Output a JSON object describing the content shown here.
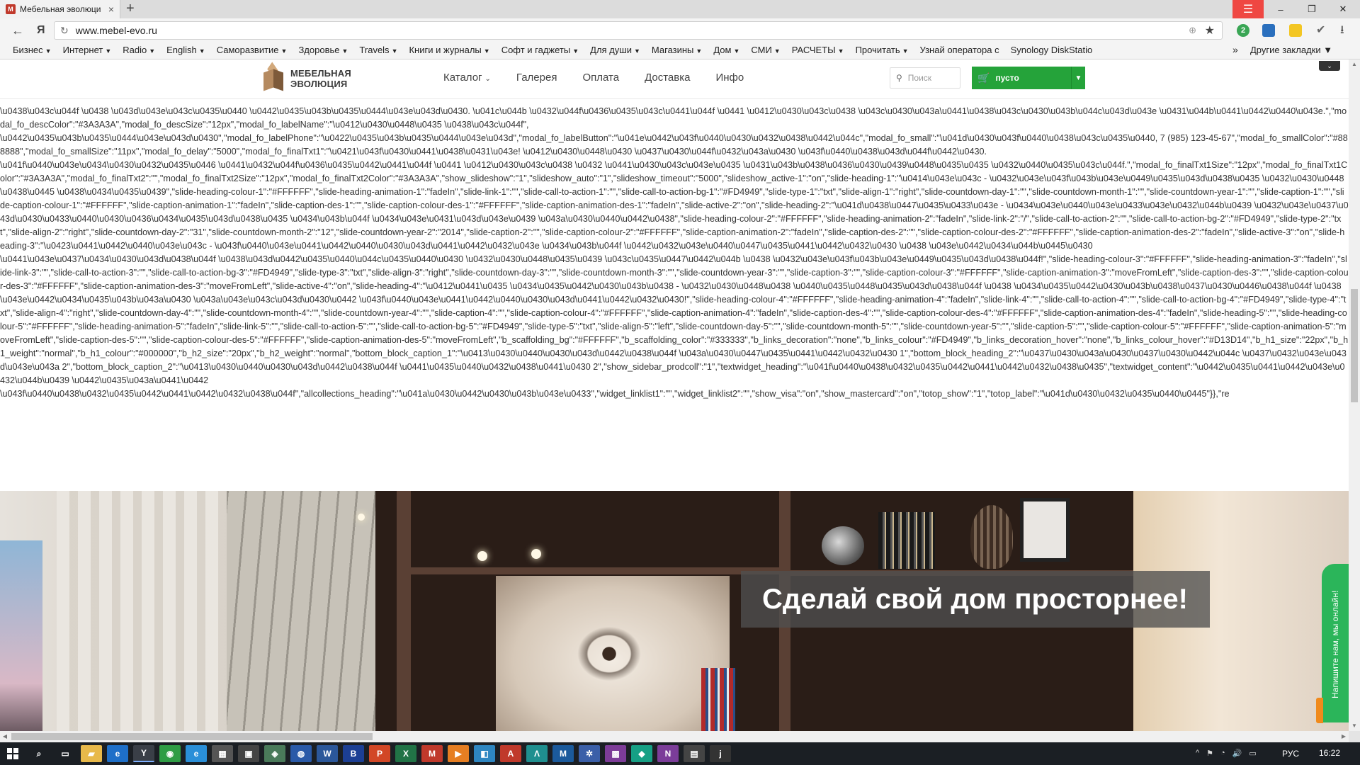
{
  "browser": {
    "tab_title": "Мебельная эволюци",
    "tab_close": "×",
    "new_tab": "+",
    "url": "www.mebel-evo.ru",
    "window_controls": {
      "menu": "☰",
      "minimize": "–",
      "maximize": "❐",
      "close": "✕"
    },
    "nav": {
      "back": "←",
      "yandex": "Я",
      "reload": "↻",
      "star": "★",
      "protect": "⊕",
      "download": "⭳"
    },
    "badge_count": "2",
    "extensions": [
      {
        "name": "green-badge-icon",
        "color": "#3aa655"
      },
      {
        "name": "bookmark-ext-icon",
        "color": "#2a6fbd"
      },
      {
        "name": "note-ext-icon",
        "color": "#f3c623"
      },
      {
        "name": "check-ext-icon",
        "color": "#666666"
      }
    ]
  },
  "bookmarks": {
    "items": [
      {
        "label": "Бизнес",
        "caret": "▼"
      },
      {
        "label": "Интернет",
        "caret": "▼"
      },
      {
        "label": "Radio",
        "caret": "▼"
      },
      {
        "label": "English",
        "caret": "▼"
      },
      {
        "label": "Саморазвитие",
        "caret": "▼"
      },
      {
        "label": "Здоровье",
        "caret": "▼"
      },
      {
        "label": "Travels",
        "caret": "▼"
      },
      {
        "label": "Книги и журналы",
        "caret": "▼"
      },
      {
        "label": "Софт и гаджеты",
        "caret": "▼"
      },
      {
        "label": "Для души",
        "caret": "▼"
      },
      {
        "label": "Магазины",
        "caret": "▼"
      },
      {
        "label": "Дом",
        "caret": "▼"
      },
      {
        "label": "СМИ",
        "caret": "▼"
      },
      {
        "label": "РАСЧЕТЫ",
        "caret": "▼"
      },
      {
        "label": "Прочитать",
        "caret": "▼"
      },
      {
        "label": "Узнай оператора с",
        "caret": ""
      },
      {
        "label": "Synology DiskStatio",
        "caret": ""
      }
    ],
    "more": "»",
    "other": "Другие закладки ▼"
  },
  "site": {
    "logo_line1": "МЕБЕЛЬНАЯ",
    "logo_line2": "ЭВОЛЮЦИЯ",
    "nav": [
      {
        "label": "Каталог",
        "caret": "⌄"
      },
      {
        "label": "Галерея",
        "caret": ""
      },
      {
        "label": "Оплата",
        "caret": ""
      },
      {
        "label": "Доставка",
        "caret": ""
      },
      {
        "label": "Инфо",
        "caret": ""
      }
    ],
    "search_placeholder": "Поиск",
    "cart_label": "пусто",
    "cart_dropdown": "▼",
    "collapse": "⌄"
  },
  "leaked_text": [
    "\\u0438\\u043c\\u044f \\u0438 \\u043d\\u043e\\u043c\\u0435\\u0440 \\u0442\\u0435\\u043b\\u0435\\u0444\\u043e\\u043d\\u0430. \\u041c\\u044b \\u0432\\u044f\\u0436\\u0435\\u043c\\u0441\\u044f \\u0441 \\u0412\\u0430\\u043c\\u0438 \\u043c\\u0430\\u043a\\u0441\\u0438\\u043c\\u0430\\u043b\\u044c\\u043d\\u043e \\u0431\\u044b\\u0441\\u0442\\u0440\\u043e.\",\"modal_fo_descColor\":\"#3A3A3A\",\"modal_fo_descSize\":\"12px\",\"modal_fo_labelName\":\"\\u0412\\u0430\\u0448\\u0435 \\u0438\\u043c\\u044f\",",
    "\\u0442\\u0435\\u043b\\u0435\\u0444\\u043e\\u043d\\u0430\",\"modal_fo_labelPhone\":\"\\u0422\\u0435\\u043b\\u0435\\u0444\\u043e\\u043d\",\"modal_fo_labelButton\":\"\\u041e\\u0442\\u043f\\u0440\\u0430\\u0432\\u0438\\u0442\\u044c\",\"modal_fo_small\":\"\\u041d\\u0430\\u043f\\u0440\\u0438\\u043c\\u0435\\u0440, 7 (985) 123-45-67\",\"modal_fo_smallColor\":\"#888888\",\"modal_fo_smallSize\":\"11px\",\"modal_fo_delay\":\"5000\",\"modal_fo_finalTxt1\":\"\\u0421\\u043f\\u0430\\u0441\\u0438\\u0431\\u043e! \\u0412\\u0430\\u0448\\u0430 \\u0437\\u0430\\u044f\\u0432\\u043a\\u0430 \\u043f\\u0440\\u0438\\u043d\\u044f\\u0442\\u0430.",
    "\\u041f\\u0440\\u043e\\u0434\\u0430\\u0432\\u0435\\u0446 \\u0441\\u0432\\u044f\\u0436\\u0435\\u0442\\u0441\\u044f \\u0441 \\u0412\\u0430\\u043c\\u0438 \\u0432 \\u0441\\u0430\\u043c\\u043e\\u0435 \\u0431\\u043b\\u0438\\u0436\\u0430\\u0439\\u0448\\u0435\\u0435 \\u0432\\u0440\\u0435\\u043c\\u044f.\",\"modal_fo_finalTxt1Size\":\"12px\",\"modal_fo_finalTxt1Color\":\"#3A3A3A\",\"modal_fo_finalTxt2\":\"\",\"modal_fo_finalTxt2Size\":\"12px\",\"modal_fo_finalTxt2Color\":\"#3A3A3A\",\"show_slideshow\":\"1\",\"slideshow_auto\":\"1\",\"slideshow_timeout\":\"5000\",\"slideshow_active-1\":\"on\",\"slide-heading-1\":\"\\u0414\\u043e\\u043c - \\u0432\\u043e\\u043f\\u043b\\u043e\\u0449\\u0435\\u043d\\u0438\\u0435 \\u0432\\u0430\\u0448\\u0438\\u0445 \\u0438\\u0434\\u0435\\u0439\",\"slide-heading-colour-1\":\"#FFFFFF\",\"slide-heading-animation-1\":\"fadeIn\",\"slide-link-1\":\"\",\"slide-call-to-action-1\":\"\",\"slide-call-to-action-bg-1\":\"#FD4949\",\"slide-type-1\":\"txt\",\"slide-align-1\":\"right\",\"slide-countdown-day-1\":\"\",\"slide-countdown-month-1\":\"\",\"slide-countdown-year-1\":\"\",\"slide-caption-1\":\"\",\"slide-caption-colour-1\":\"#FFFFFF\",\"slide-caption-animation-1\":\"fadeIn\",\"slide-caption-des-1\":\"\",\"slide-caption-colour-des-1\":\"#FFFFFF\",\"slide-caption-animation-des-1\":\"fadeIn\",\"slide-active-2\":\"on\",\"slide-heading-2\":\"\\u041d\\u0438\\u0447\\u0435\\u0433\\u043e - \\u0434\\u043e\\u0440\\u043e\\u0433\\u043e\\u0432\\u044b\\u0439 \\u0432\\u043e\\u0437\\u043d\\u0430\\u0433\\u0440\\u0430\\u0436\\u0434\\u0435\\u043d\\u0438\\u0435 \\u0434\\u043b\\u044f \\u0434\\u043e\\u0431\\u043d\\u043e\\u0439 \\u043a\\u0430\\u0440\\u0442\\u0438\",\"slide-heading-colour-2\":\"#FFFFFF\",\"slide-heading-animation-2\":\"fadeIn\",\"slide-link-2\":\"/\",\"slide-call-to-action-2\":\"\",\"slide-call-to-action-bg-2\":\"#FD4949\",\"slide-type-2\":\"txt\",\"slide-align-2\":\"right\",\"slide-countdown-day-2\":\"31\",\"slide-countdown-month-2\":\"12\",\"slide-countdown-year-2\":\"2014\",\"slide-caption-2\":\"\",\"slide-caption-colour-2\":\"#FFFFFF\",\"slide-caption-animation-2\":\"fadeIn\",\"slide-caption-des-2\":\"\",\"slide-caption-colour-des-2\":\"#FFFFFF\",\"slide-caption-animation-des-2\":\"fadeIn\",\"slide-active-3\":\"on\",\"slide-heading-3\":\"\\u0423\\u0441\\u0442\\u0440\\u043e\\u043c - \\u043f\\u0440\\u043e\\u0441\\u0442\\u0440\\u0430\\u043d\\u0441\\u0442\\u0432\\u043e \\u0434\\u043b\\u044f \\u0442\\u0432\\u043e\\u0440\\u0447\\u0435\\u0441\\u0442\\u0432\\u0430 \\u0438 \\u043e\\u0442\\u0434\\u044b\\u0445\\u0430",
    "\\u0441\\u043e\\u0437\\u0434\\u0430\\u043d\\u0438\\u044f \\u0438\\u043d\\u0442\\u0435\\u0440\\u044c\\u0435\\u0440\\u0430 \\u0432\\u0430\\u0448\\u0435\\u0439 \\u043c\\u0435\\u0447\\u0442\\u044b \\u0438 \\u0432\\u043e\\u043f\\u043b\\u043e\\u0449\\u0435\\u043d\\u0438\\u044f!\",\"slide-heading-colour-3\":\"#FFFFFF\",\"slide-heading-animation-3\":\"fadeIn\",\"slide-link-3\":\"\",\"slide-call-to-action-3\":\"\",\"slide-call-to-action-bg-3\":\"#FD4949\",\"slide-type-3\":\"txt\",\"slide-align-3\":\"right\",\"slide-countdown-day-3\":\"\",\"slide-countdown-month-3\":\"\",\"slide-countdown-year-3\":\"\",\"slide-caption-3\":\"\",\"slide-caption-colour-3\":\"#FFFFFF\",\"slide-caption-animation-3\":\"moveFromLeft\",\"slide-caption-des-3\":\"\",\"slide-caption-colour-des-3\":\"#FFFFFF\",\"slide-caption-animation-des-3\":\"moveFromLeft\",\"slide-active-4\":\"on\",\"slide-heading-4\":\"\\u0412\\u0441\\u0435 \\u0434\\u0435\\u0442\\u0430\\u043b\\u0438 - \\u0432\\u0430\\u0448\\u0438 \\u0440\\u0435\\u0448\\u0435\\u043d\\u0438\\u044f \\u0438 \\u0434\\u0435\\u0442\\u0430\\u043b\\u0438\\u0437\\u0430\\u0446\\u0438\\u044f \\u0438 \\u043e\\u0442\\u0434\\u0435\\u043b\\u043a\\u0430 \\u043a\\u043e\\u043c\\u043d\\u0430\\u0442 \\u043f\\u0440\\u043e\\u0441\\u0442\\u0440\\u0430\\u043d\\u0441\\u0442\\u0432\\u0430!\",\"slide-heading-colour-4\":\"#FFFFFF\",\"slide-heading-animation-4\":\"fadeIn\",\"slide-link-4\":\"\",\"slide-call-to-action-4\":\"\",\"slide-call-to-action-bg-4\":\"#FD4949\",\"slide-type-4\":\"txt\",\"slide-align-4\":\"right\",\"slide-countdown-day-4\":\"\",\"slide-countdown-month-4\":\"\",\"slide-countdown-year-4\":\"\",\"slide-caption-4\":\"\",\"slide-caption-colour-4\":\"#FFFFFF\",\"slide-caption-animation-4\":\"fadeIn\",\"slide-caption-des-4\":\"\",\"slide-caption-colour-des-4\":\"#FFFFFF\",\"slide-caption-animation-des-4\":\"fadeIn\",\"slide-heading-5\":\"\",\"slide-heading-colour-5\":\"#FFFFFF\",\"slide-heading-animation-5\":\"fadeIn\",\"slide-link-5\":\"\",\"slide-call-to-action-5\":\"\",\"slide-call-to-action-bg-5\":\"#FD4949\",\"slide-type-5\":\"txt\",\"slide-align-5\":\"left\",\"slide-countdown-day-5\":\"\",\"slide-countdown-month-5\":\"\",\"slide-countdown-year-5\":\"\",\"slide-caption-5\":\"\",\"slide-caption-colour-5\":\"#FFFFFF\",\"slide-caption-animation-5\":\"moveFromLeft\",\"slide-caption-des-5\":\"\",\"slide-caption-colour-des-5\":\"#FFFFFF\",\"slide-caption-animation-des-5\":\"moveFromLeft\",\"b_scaffolding_bg\":\"#FFFFFF\",\"b_scaffolding_color\":\"#333333\",\"b_links_decoration\":\"none\",\"b_links_colour\":\"#FD4949\",\"b_links_decoration_hover\":\"none\",\"b_links_colour_hover\":\"#D13D14\",\"b_h1_size\":\"22px\",\"b_h1_weight\":\"normal\",\"b_h1_colour\":\"#000000\",\"b_h2_size\":\"20px\",\"b_h2_weight\":\"normal\",\"bottom_block_caption_1\":\"\\u0413\\u0430\\u0440\\u0430\\u043d\\u0442\\u0438\\u044f \\u043a\\u0430\\u0447\\u0435\\u0441\\u0442\\u0432\\u0430 1\",\"bottom_block_heading_2\":\"\\u0437\\u0430\\u043a\\u0430\\u0437\\u0430\\u0442\\u044c \\u0437\\u0432\\u043e\\u043d\\u043e\\u043a 2\",\"bottom_block_caption_2\":\"\\u0413\\u0430\\u0440\\u0430\\u043d\\u0442\\u0438\\u044f \\u0441\\u0435\\u0440\\u0432\\u0438\\u0441\\u0430 2\",\"show_sidebar_prodcoll\":\"1\",\"textwidget_heading\":\"\\u041f\\u0440\\u0438\\u0432\\u0435\\u0442\\u0441\\u0442\\u0432\\u0438\\u0435\",\"textwidget_content\":\"\\u0442\\u0435\\u0441\\u0442\\u043e\\u0432\\u044b\\u0439 \\u0442\\u0435\\u043a\\u0441\\u0442",
    "\\u043f\\u0440\\u0438\\u0432\\u0435\\u0442\\u0441\\u0442\\u0432\\u0438\\u044f\",\"allcollections_heading\":\"\\u041a\\u0430\\u0442\\u0430\\u043b\\u043e\\u0433\",\"widget_linklist1\":\"\",\"widget_linklist2\":\"\",\"show_visa\":\"on\",\"show_mastercard\":\"on\",\"totop_show\":\"1\",\"totop_label\":\"\\u041d\\u0430\\u0432\\u0435\\u0440\\u0445\"}},\"re"
  ],
  "hero": {
    "caption": "Сделай свой дом просторнее!"
  },
  "chat": {
    "label": "Напишите нам, мы онлайн!"
  },
  "scroll": {
    "up": "▲",
    "down": "▼",
    "left": "◀",
    "right": "▶"
  },
  "taskbar": {
    "icons": [
      {
        "name": "search-icon",
        "glyph": "⌕",
        "bg": "transparent"
      },
      {
        "name": "task-view-icon",
        "glyph": "▭",
        "bg": "transparent"
      },
      {
        "name": "explorer-icon",
        "glyph": "▰",
        "bg": "#e8b94a"
      },
      {
        "name": "edge-icon",
        "glyph": "e",
        "bg": "#1e6fc8"
      },
      {
        "name": "yandex-browser-icon",
        "glyph": "Y",
        "bg": "#3a3f47"
      },
      {
        "name": "chrome-icon",
        "glyph": "◉",
        "bg": "#2f9d45"
      },
      {
        "name": "ie-icon",
        "glyph": "e",
        "bg": "#2a8fd8"
      },
      {
        "name": "store-icon",
        "glyph": "▦",
        "bg": "#555555"
      },
      {
        "name": "app-icon",
        "glyph": "▣",
        "bg": "#444444"
      },
      {
        "name": "app2-icon",
        "glyph": "◈",
        "bg": "#4a7a5a"
      },
      {
        "name": "app3-icon",
        "glyph": "◍",
        "bg": "#2a5aa8"
      },
      {
        "name": "word-icon",
        "glyph": "W",
        "bg": "#2b579a"
      },
      {
        "name": "app4-icon",
        "glyph": "B",
        "bg": "#1c3f94"
      },
      {
        "name": "powerpoint-icon",
        "glyph": "P",
        "bg": "#d24726"
      },
      {
        "name": "excel-icon",
        "glyph": "X",
        "bg": "#217346"
      },
      {
        "name": "mail-icon",
        "glyph": "M",
        "bg": "#c0392b"
      },
      {
        "name": "app5-icon",
        "glyph": "▶",
        "bg": "#e67e22"
      },
      {
        "name": "app6-icon",
        "glyph": "◧",
        "bg": "#2e86c1"
      },
      {
        "name": "acrobat-icon",
        "glyph": "A",
        "bg": "#c0392b"
      },
      {
        "name": "app7-icon",
        "glyph": "Λ",
        "bg": "#1f8f8f"
      },
      {
        "name": "app8-icon",
        "glyph": "M",
        "bg": "#1b5a9c"
      },
      {
        "name": "app9-icon",
        "glyph": "✲",
        "bg": "#3b5fa8"
      },
      {
        "name": "app10-icon",
        "glyph": "▩",
        "bg": "#7d3c98"
      },
      {
        "name": "app11-icon",
        "glyph": "◆",
        "bg": "#16a085"
      },
      {
        "name": "onenote-icon",
        "glyph": "N",
        "bg": "#7b3d99"
      },
      {
        "name": "calculator-icon",
        "glyph": "▤",
        "bg": "#444444"
      },
      {
        "name": "app12-icon",
        "glyph": "j",
        "bg": "#333333"
      }
    ],
    "tray": [
      "^",
      "⚑",
      "◔",
      "🔊",
      "▭"
    ],
    "lang": "РУС",
    "time": "16:22"
  }
}
